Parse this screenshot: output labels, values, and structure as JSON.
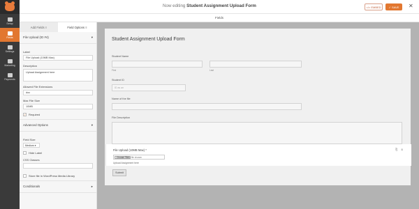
{
  "header": {
    "editing_prefix": "Now editing",
    "form_name": "Student Assignment Upload Form",
    "embed_label": "</> EMBED",
    "save_label": "✓ SAVE",
    "close_glyph": "✕"
  },
  "fields_strip": {
    "label": "Fields"
  },
  "nav": [
    {
      "label": "Setup",
      "icon": "gear-icon"
    },
    {
      "label": "Fields",
      "icon": "fields-icon",
      "active": true
    },
    {
      "label": "Settings",
      "icon": "sliders-icon"
    },
    {
      "label": "Marketing",
      "icon": "megaphone-icon"
    },
    {
      "label": "Payments",
      "icon": "dollar-icon"
    }
  ],
  "panel": {
    "tab_add": "Add Fields ≡",
    "tab_options": "Field Options ≡",
    "section_title": "File Upload (ID #4)",
    "section_toggle": "▾",
    "label_label": "Label",
    "label_value": "File Upload (10MB Max)",
    "description_label": "Description",
    "description_value": "Upload Assignment here",
    "extensions_label": "Allowed File Extensions",
    "extensions_value": "doc",
    "max_size_label": "Max File Size",
    "max_size_value": "10MB",
    "required_label": "Required",
    "advanced_title": "Advanced Options",
    "advanced_toggle": "▾",
    "field_size_label": "Field Size",
    "field_size_value": "Medium ▾",
    "hide_label": "Hide Label",
    "css_label": "CSS Classes",
    "css_value": "",
    "media_label": "Store file in WordPress Media Library",
    "conditionals_title": "Conditionals",
    "conditionals_toggle": "▸"
  },
  "form": {
    "title": "Student Assignment Upload Form",
    "name_label": "Student Name",
    "first_sub": "First",
    "last_sub": "Last",
    "id_label": "Student ID",
    "id_placeholder": "ID as an",
    "file_name_label": "Name of the file",
    "file_desc_label": "File Description",
    "upload_label": "File Upload (10MB Max) *",
    "choose_label": "Choose File",
    "no_file": "No file chosen",
    "upload_desc": "Upload Assignment here",
    "field_icons": "⎘ ⊗",
    "submit_label": "Submit"
  }
}
